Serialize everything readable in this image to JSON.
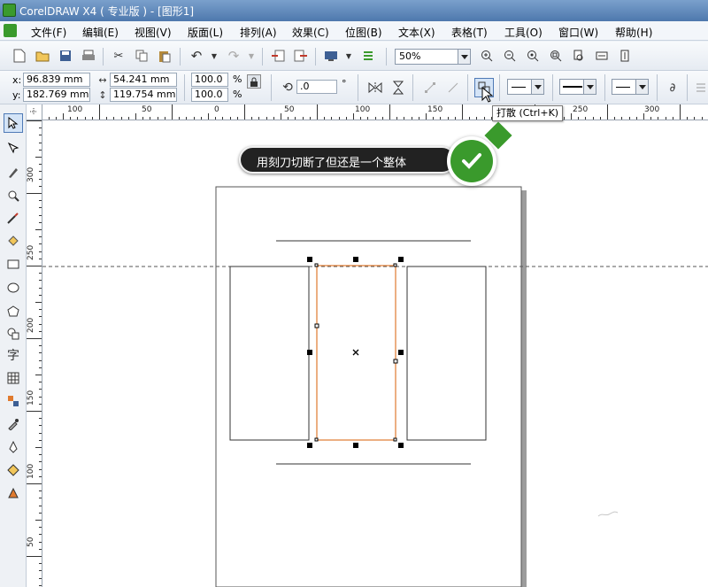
{
  "window": {
    "title": "CorelDRAW X4 ( 专业版 ) - [图形1]"
  },
  "menu": [
    "文件(F)",
    "编辑(E)",
    "视图(V)",
    "版面(L)",
    "排列(A)",
    "效果(C)",
    "位图(B)",
    "文本(X)",
    "表格(T)",
    "工具(O)",
    "窗口(W)",
    "帮助(H)"
  ],
  "toolbar": {
    "zoom": "50%"
  },
  "property_bar": {
    "x_label": "x:",
    "x_value": "96.839 mm",
    "y_label": "y:",
    "y_value": "182.769 mm",
    "width_value": "54.241 mm",
    "height_value": "119.754 mm",
    "scale_x": "100.0",
    "scale_y": "100.0",
    "percent": "%",
    "angle_value": ".0",
    "degree": "°"
  },
  "tooltip": {
    "text": "打散 (Ctrl+K)"
  },
  "callout": {
    "text": "用刻刀切断了但还是一个整体"
  },
  "ruler_h": {
    "labels": [
      "100",
      "50",
      "0",
      "50",
      "100",
      "150",
      "200",
      "250",
      "300"
    ]
  },
  "ruler_v": {
    "labels": [
      "300",
      "250",
      "200",
      "150",
      "100",
      "50"
    ]
  },
  "toolbox": {
    "text_tool_glyph": "字"
  },
  "colors": {
    "accent_green": "#3a9a2c",
    "selection_orange": "#e07a2e",
    "callout_bg": "#222222"
  }
}
